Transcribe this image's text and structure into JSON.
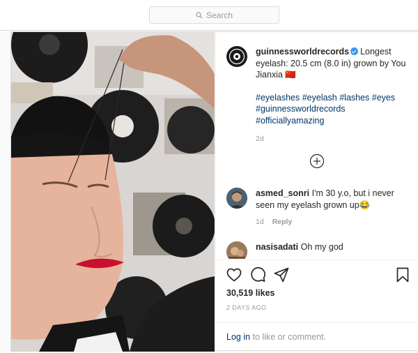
{
  "search": {
    "placeholder": "Search"
  },
  "post": {
    "author": "guinnessworldrecords",
    "caption": "Longest eyelash: 20.5 cm (8.0 in) grown by You Jianxia",
    "flag": "🇨🇳",
    "hashtags": "#eyelashes #eyelash #lashes #eyes #guinnessworldrecords #officiallyamazing",
    "time": "2d"
  },
  "comments": [
    {
      "user": "asmed_sonri",
      "text": "I'm 30 y.o, but i never seen my eyelash grown up😂",
      "time": "1d",
      "reply": "Reply"
    },
    {
      "user": "nasisadati",
      "text": "Oh my god"
    }
  ],
  "stats": {
    "likes": "30,519 likes",
    "ago": "2 DAYS AGO"
  },
  "login": {
    "link": "Log in",
    "rest": " to like or comment."
  },
  "colors": {
    "link": "#003569",
    "verified": "#3897f0",
    "lips": "#c8102e"
  }
}
